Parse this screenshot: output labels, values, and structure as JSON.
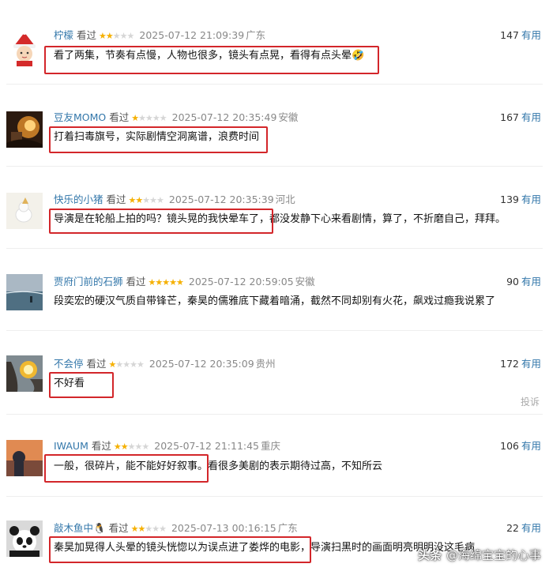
{
  "reviews": [
    {
      "user": "柠檬",
      "seen": "看过",
      "rating": 2,
      "time": "2025-07-12 21:09:39",
      "location": "广东",
      "useful_count": "147",
      "useful_label": "有用",
      "comment": "看了两集，节奏有点慢，人物也很多，镜头有点晃，看得有点头晕🤣"
    },
    {
      "user": "豆友MOMO",
      "seen": "看过",
      "rating": 1,
      "time": "2025-07-12 20:35:49",
      "location": "安徽",
      "useful_count": "167",
      "useful_label": "有用",
      "comment": "打着扫毒旗号，实际剧情空洞离谱，浪费时间"
    },
    {
      "user": "快乐的小猪",
      "seen": "看过",
      "rating": 2,
      "time": "2025-07-12 20:35:39",
      "location": "河北",
      "useful_count": "139",
      "useful_label": "有用",
      "comment": "导演是在轮船上拍的吗？镜头晃的我快晕车了，都没发静下心来看剧情，算了，不折磨自己，拜拜。"
    },
    {
      "user": "贾府门前的石狮",
      "seen": "看过",
      "rating": 5,
      "time": "2025-07-12 20:59:05",
      "location": "安徽",
      "useful_count": "90",
      "useful_label": "有用",
      "comment": "段奕宏的硬汉气质自带锋芒，秦昊的儒雅底下藏着暗涌，截然不同却别有火花，飙戏过瘾我说累了"
    },
    {
      "user": "不会停",
      "seen": "看过",
      "rating": 1,
      "time": "2025-07-12 20:35:09",
      "location": "贵州",
      "useful_count": "172",
      "useful_label": "有用",
      "comment": "不好看"
    },
    {
      "user": "IWAUM",
      "seen": "看过",
      "rating": 2,
      "time": "2025-07-12 21:11:45",
      "location": "重庆",
      "useful_count": "106",
      "useful_label": "有用",
      "comment": "一般，很碎片，能不能好好叙事。看很多美剧的表示期待过高，不知所云"
    },
    {
      "user": "敲木鱼中🐧",
      "seen": "看过",
      "rating": 2,
      "time": "2025-07-13 00:16:15",
      "location": "广东",
      "useful_count": "22",
      "useful_label": "有用",
      "comment": "秦昊加晃得人头晕的镜头恍惚以为误点进了娄烨的电影，导演扫黑时的画面明亮明明没这毛病"
    }
  ],
  "report_label": "投诉",
  "watermark": {
    "brand": "头条",
    "handle": "@海绵宝宝的心事"
  },
  "colors": {
    "username": "#3377aa",
    "star": "#f5b000",
    "highlight": "#d3262a"
  }
}
